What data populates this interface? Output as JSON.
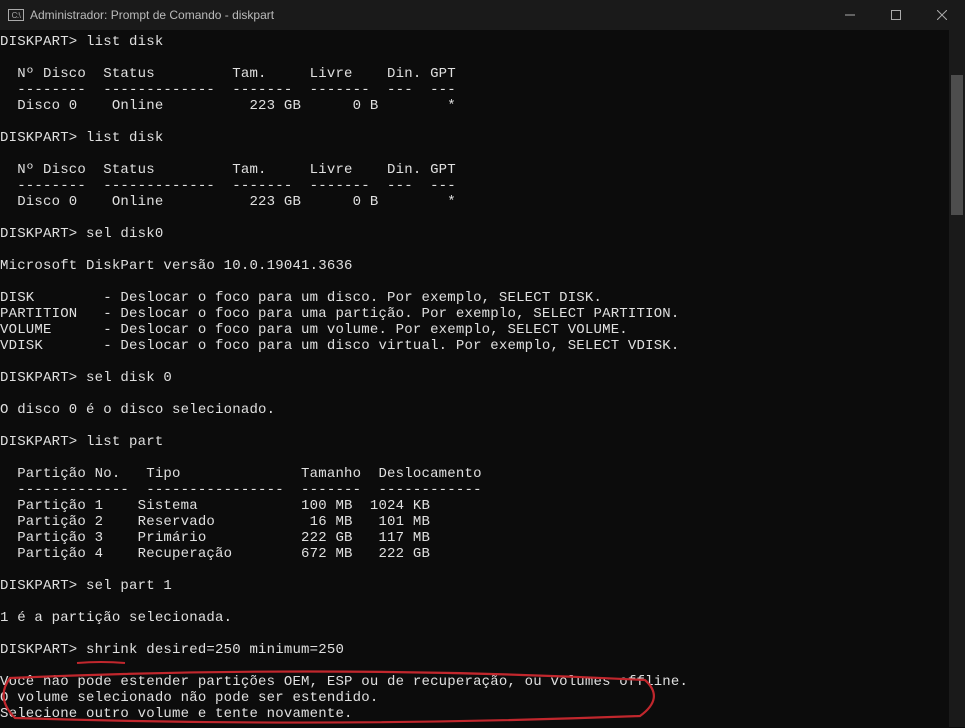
{
  "window": {
    "title": "Administrador: Prompt de Comando - diskpart"
  },
  "lines": [
    "DISKPART> list disk",
    "",
    "  Nº Disco  Status         Tam.     Livre    Din. GPT",
    "  --------  -------------  -------  -------  ---  ---",
    "  Disco 0    Online          223 GB      0 B        *",
    "",
    "DISKPART> list disk",
    "",
    "  Nº Disco  Status         Tam.     Livre    Din. GPT",
    "  --------  -------------  -------  -------  ---  ---",
    "  Disco 0    Online          223 GB      0 B        *",
    "",
    "DISKPART> sel disk0",
    "",
    "Microsoft DiskPart versão 10.0.19041.3636",
    "",
    "DISK        - Deslocar o foco para um disco. Por exemplo, SELECT DISK.",
    "PARTITION   - Deslocar o foco para uma partição. Por exemplo, SELECT PARTITION.",
    "VOLUME      - Deslocar o foco para um volume. Por exemplo, SELECT VOLUME.",
    "VDISK       - Deslocar o foco para um disco virtual. Por exemplo, SELECT VDISK.",
    "",
    "DISKPART> sel disk 0",
    "",
    "O disco 0 é o disco selecionado.",
    "",
    "DISKPART> list part",
    "",
    "  Partição No.   Tipo              Tamanho  Deslocamento",
    "  -------------  ----------------  -------  ------------",
    "  Partição 1    Sistema            100 MB  1024 KB",
    "  Partição 2    Reservado           16 MB   101 MB",
    "  Partição 3    Primário           222 GB   117 MB",
    "  Partição 4    Recuperação        672 MB   222 GB",
    "",
    "DISKPART> sel part 1",
    "",
    "1 é a partição selecionada.",
    "",
    "DISKPART> shrink desired=250 minimum=250",
    "",
    "Você não pode estender partições OEM, ESP ou de recuperação, ou volumes offline.",
    "O volume selecionado não pode ser estendido.",
    "Selecione outro volume e tente novamente."
  ]
}
